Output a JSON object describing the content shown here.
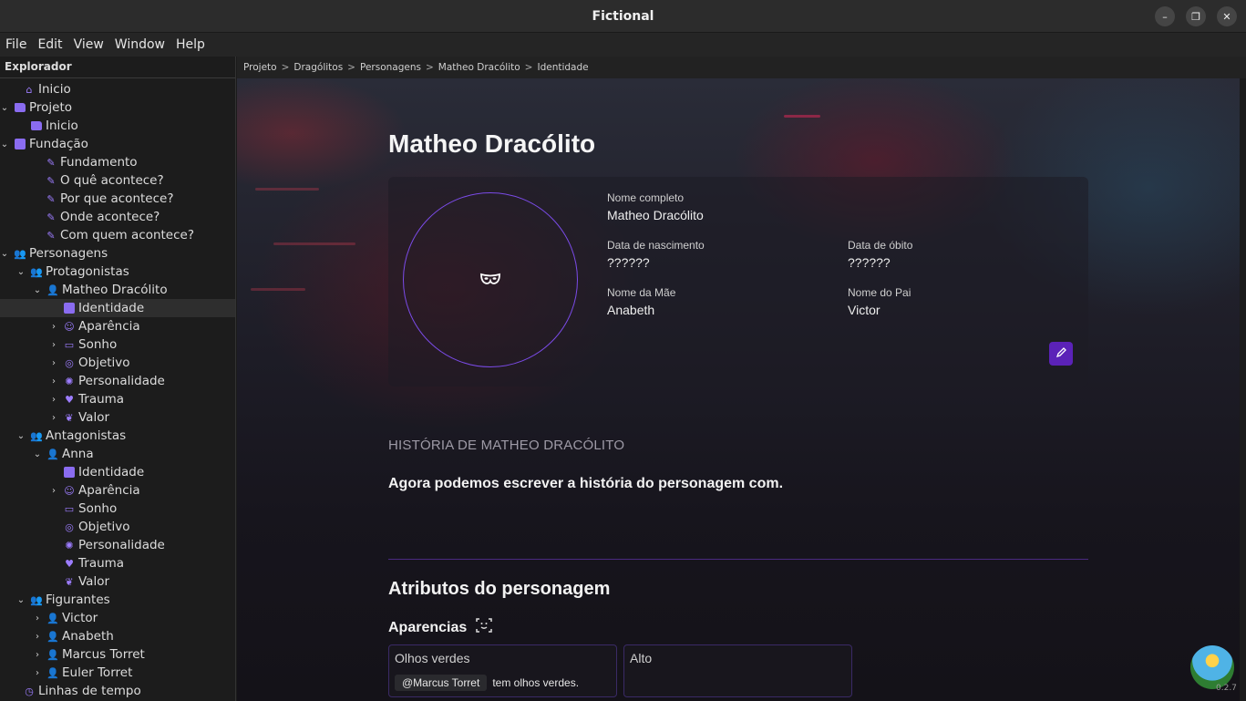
{
  "window": {
    "title": "Fictional",
    "minimize": "–",
    "restore": "❐",
    "close": "✕"
  },
  "menu": [
    "File",
    "Edit",
    "View",
    "Window",
    "Help"
  ],
  "sidebar": {
    "header": "Explorador",
    "items": [
      {
        "label": "Inicio",
        "chev": "",
        "icon": "home-icon",
        "glyph": "⌂"
      },
      {
        "label": "Projeto",
        "chev": "⌄",
        "icon": "folder-icon",
        "glyph": ""
      },
      {
        "label": "Inicio",
        "chev": "",
        "icon": "folder-icon",
        "glyph": ""
      },
      {
        "label": "Fundação",
        "chev": "⌄",
        "icon": "book-icon",
        "glyph": ""
      },
      {
        "label": "Fundamento",
        "chev": "",
        "icon": "scroll-icon",
        "glyph": "✎"
      },
      {
        "label": "O quê acontece?",
        "chev": "",
        "icon": "scroll-icon",
        "glyph": "✎"
      },
      {
        "label": "Por que acontece?",
        "chev": "",
        "icon": "scroll-icon",
        "glyph": "✎"
      },
      {
        "label": "Onde acontece?",
        "chev": "",
        "icon": "scroll-icon",
        "glyph": "✎"
      },
      {
        "label": "Com quem acontece?",
        "chev": "",
        "icon": "scroll-icon",
        "glyph": "✎"
      },
      {
        "label": "Personagens",
        "chev": "⌄",
        "icon": "group-icon",
        "glyph": "👥"
      },
      {
        "label": "Protagonistas",
        "chev": "⌄",
        "icon": "group-icon",
        "glyph": "👥"
      },
      {
        "label": "Matheo Dracólito",
        "chev": "⌄",
        "icon": "person-icon",
        "glyph": "👤"
      },
      {
        "label": "Identidade",
        "chev": "",
        "icon": "id-card-icon",
        "glyph": ""
      },
      {
        "label": "Aparência",
        "chev": "›",
        "icon": "face-scan-icon",
        "glyph": "☺"
      },
      {
        "label": "Sonho",
        "chev": "›",
        "icon": "bed-icon",
        "glyph": "▭"
      },
      {
        "label": "Objetivo",
        "chev": "›",
        "icon": "target-icon",
        "glyph": "◎"
      },
      {
        "label": "Personalidade",
        "chev": "›",
        "icon": "brain-icon",
        "glyph": "✺"
      },
      {
        "label": "Trauma",
        "chev": "›",
        "icon": "broken-heart-icon",
        "glyph": "♥"
      },
      {
        "label": "Valor",
        "chev": "›",
        "icon": "leaf-icon",
        "glyph": "❦"
      },
      {
        "label": "Antagonistas",
        "chev": "⌄",
        "icon": "group-icon",
        "glyph": "👥"
      },
      {
        "label": "Anna",
        "chev": "⌄",
        "icon": "person-icon",
        "glyph": "👤"
      },
      {
        "label": "Identidade",
        "chev": "",
        "icon": "id-card-icon",
        "glyph": ""
      },
      {
        "label": "Aparência",
        "chev": "›",
        "icon": "face-scan-icon",
        "glyph": "☺"
      },
      {
        "label": "Sonho",
        "chev": "",
        "icon": "bed-icon",
        "glyph": "▭"
      },
      {
        "label": "Objetivo",
        "chev": "",
        "icon": "target-icon",
        "glyph": "◎"
      },
      {
        "label": "Personalidade",
        "chev": "",
        "icon": "brain-icon",
        "glyph": "✺"
      },
      {
        "label": "Trauma",
        "chev": "",
        "icon": "broken-heart-icon",
        "glyph": "♥"
      },
      {
        "label": "Valor",
        "chev": "",
        "icon": "leaf-icon",
        "glyph": "❦"
      },
      {
        "label": "Figurantes",
        "chev": "⌄",
        "icon": "group-icon",
        "glyph": "👥"
      },
      {
        "label": "Victor",
        "chev": "›",
        "icon": "person-icon",
        "glyph": "👤"
      },
      {
        "label": "Anabeth",
        "chev": "›",
        "icon": "person-icon",
        "glyph": "👤"
      },
      {
        "label": "Marcus Torret",
        "chev": "›",
        "icon": "person-icon",
        "glyph": "👤"
      },
      {
        "label": "Euler Torret",
        "chev": "›",
        "icon": "person-icon",
        "glyph": "👤"
      },
      {
        "label": "Linhas de tempo",
        "chev": "",
        "icon": "clock-icon",
        "glyph": "◷"
      }
    ]
  },
  "breadcrumb": [
    "Projeto",
    "Dragólitos",
    "Personagens",
    "Matheo Dracólito",
    "Identidade"
  ],
  "character": {
    "name": "Matheo Dracólito",
    "full_name_label": "Nome completo",
    "full_name": "Matheo Dracólito",
    "birth_label": "Data de nascimento",
    "birth": "??????",
    "death_label": "Data de óbito",
    "death": "??????",
    "mother_label": "Nome da Mãe",
    "mother": "Anabeth",
    "father_label": "Nome do Pai",
    "father": "Victor"
  },
  "history": {
    "label": "HISTÓRIA DE MATHEO DRACÓLITO",
    "text": "Agora podemos escrever a história do personagem com."
  },
  "attributes": {
    "title": "Atributos do personagem",
    "appearance_title": "Aparencias",
    "cards": [
      {
        "title": "Olhos verdes",
        "mention": "@Marcus Torret",
        "text": "tem olhos verdes."
      },
      {
        "title": "Alto",
        "mention": "",
        "text": ""
      }
    ]
  },
  "version": "0.2.7",
  "colors": {
    "accent": "#7b4be8",
    "edit_button": "#5b22b8"
  }
}
